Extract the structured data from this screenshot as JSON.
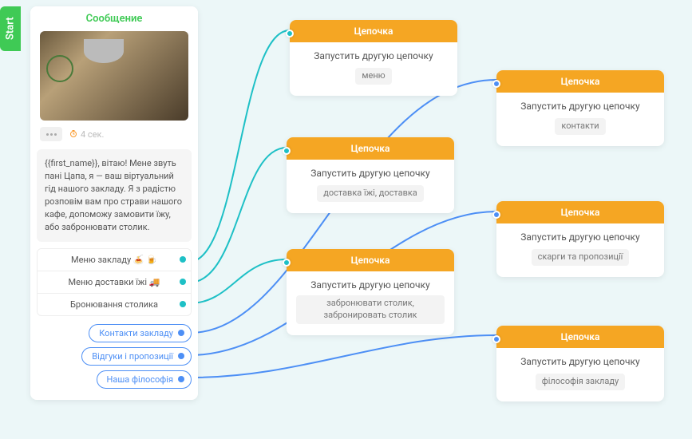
{
  "start_tab": "Start",
  "message": {
    "header": "Сообщение",
    "timer": "4 сек.",
    "body": "{{first_name}}, вітаю! Мене звуть пані Цапа, я — ваш віртуальний гід нашого закладу. Я з радістю розповім вам про страви нашого кафе, допоможу замовити їжу, або забронювати столик.",
    "options": [
      {
        "label": "Меню закладу 🍝 🍺"
      },
      {
        "label": "Меню доставки їжі 🚚"
      },
      {
        "label": "Бронювання столика"
      }
    ],
    "pills": [
      {
        "label": "Контакти закладу"
      },
      {
        "label": "Відгуки і пропозиції"
      },
      {
        "label": "Наша філософія"
      }
    ]
  },
  "chain_header": "Цепочка",
  "chain_action": "Запустить другую цепочку",
  "chains": [
    {
      "value": "меню"
    },
    {
      "value": "доставка їжі, доставка"
    },
    {
      "value": "забронювати столик, забронировать столик"
    },
    {
      "value": "контакти"
    },
    {
      "value": "скарги та пропозиції"
    },
    {
      "value": "філософія закладу"
    }
  ],
  "colors": {
    "start": "#3fca55",
    "chain_header": "#f5a623",
    "teal": "#1ec0c6",
    "blue": "#4d8ff5"
  },
  "chart_data": {
    "type": "diagram",
    "title": "Chatbot flow builder",
    "nodes": [
      {
        "id": "start",
        "type": "message",
        "label": "Сообщение"
      },
      {
        "id": "c1",
        "type": "chain",
        "value": "меню"
      },
      {
        "id": "c2",
        "type": "chain",
        "value": "доставка їжі, доставка"
      },
      {
        "id": "c3",
        "type": "chain",
        "value": "забронювати столик, забронировать столик"
      },
      {
        "id": "c4",
        "type": "chain",
        "value": "контакти"
      },
      {
        "id": "c5",
        "type": "chain",
        "value": "скарги та пропозиції"
      },
      {
        "id": "c6",
        "type": "chain",
        "value": "філософія закладу"
      }
    ],
    "edges": [
      {
        "from": "start.option.0",
        "to": "c1"
      },
      {
        "from": "start.option.1",
        "to": "c2"
      },
      {
        "from": "start.option.2",
        "to": "c3"
      },
      {
        "from": "start.pill.0",
        "to": "c4"
      },
      {
        "from": "start.pill.1",
        "to": "c5"
      },
      {
        "from": "start.pill.2",
        "to": "c6"
      }
    ]
  }
}
